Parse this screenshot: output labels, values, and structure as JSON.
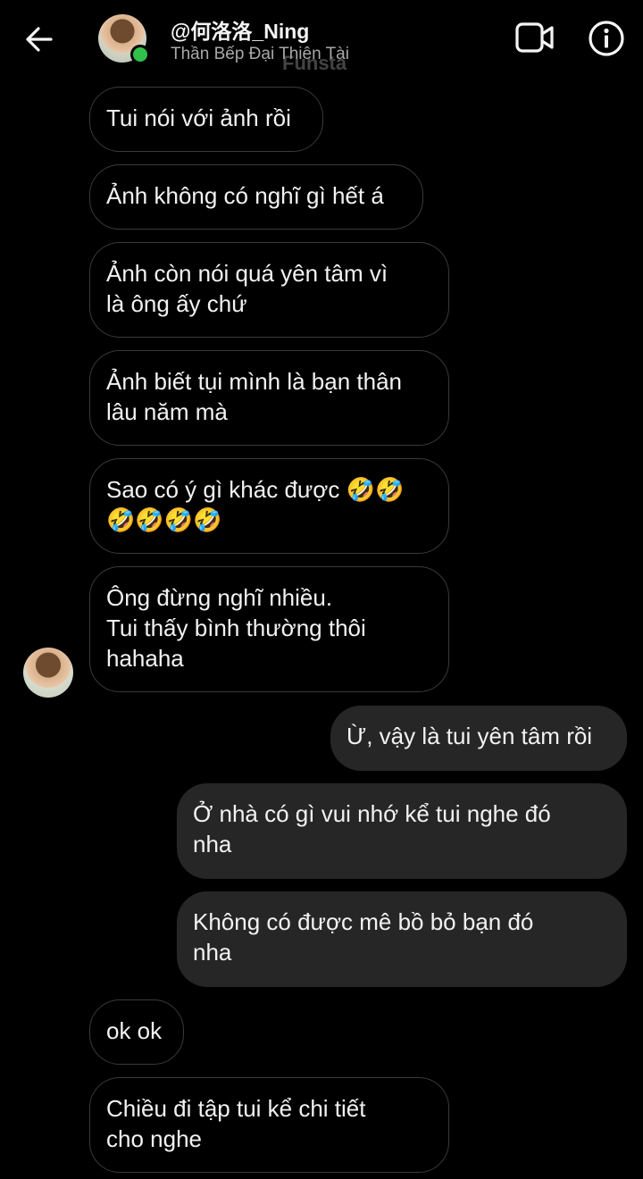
{
  "header": {
    "back_icon": "arrow-left-icon",
    "contact_name": "@何洛洛_Ning",
    "contact_subtitle": "Thần Bếp Đại Thiên Tài",
    "online_status_color": "#31c14a",
    "watermark": "Funsta",
    "video_icon": "video-camera-icon",
    "info_icon": "info-icon"
  },
  "messages": [
    {
      "side": "incoming",
      "text": "Tui nói với ảnh rồi"
    },
    {
      "side": "incoming",
      "text": "Ảnh không có nghĩ gì hết á"
    },
    {
      "side": "incoming",
      "text": "Ảnh còn nói quá yên tâm vì\nlà ông ấy chứ"
    },
    {
      "side": "incoming",
      "text": "Ảnh biết tụi mình là bạn thân\nlâu năm mà"
    },
    {
      "side": "incoming",
      "text": "Sao có ý gì khác được 🤣🤣\n🤣🤣🤣🤣"
    },
    {
      "side": "incoming",
      "text": "Ông đừng nghĩ nhiều.\nTui thấy bình thường thôi\nhahaha"
    },
    {
      "side": "outgoing",
      "text": "Ừ, vậy là tui yên tâm rồi"
    },
    {
      "side": "outgoing",
      "text": "Ở nhà có gì vui nhớ kể tui nghe đó\nnha"
    },
    {
      "side": "outgoing",
      "text": "Không có được mê bồ bỏ bạn đó\nnha"
    },
    {
      "side": "incoming",
      "text": "ok ok"
    },
    {
      "side": "incoming",
      "text": "Chiều đi tập tui kể chi tiết\ncho nghe"
    }
  ],
  "theme": {
    "background": "#000000",
    "outgoing_bubble": "#262626",
    "incoming_border": "#3a3a3a"
  }
}
